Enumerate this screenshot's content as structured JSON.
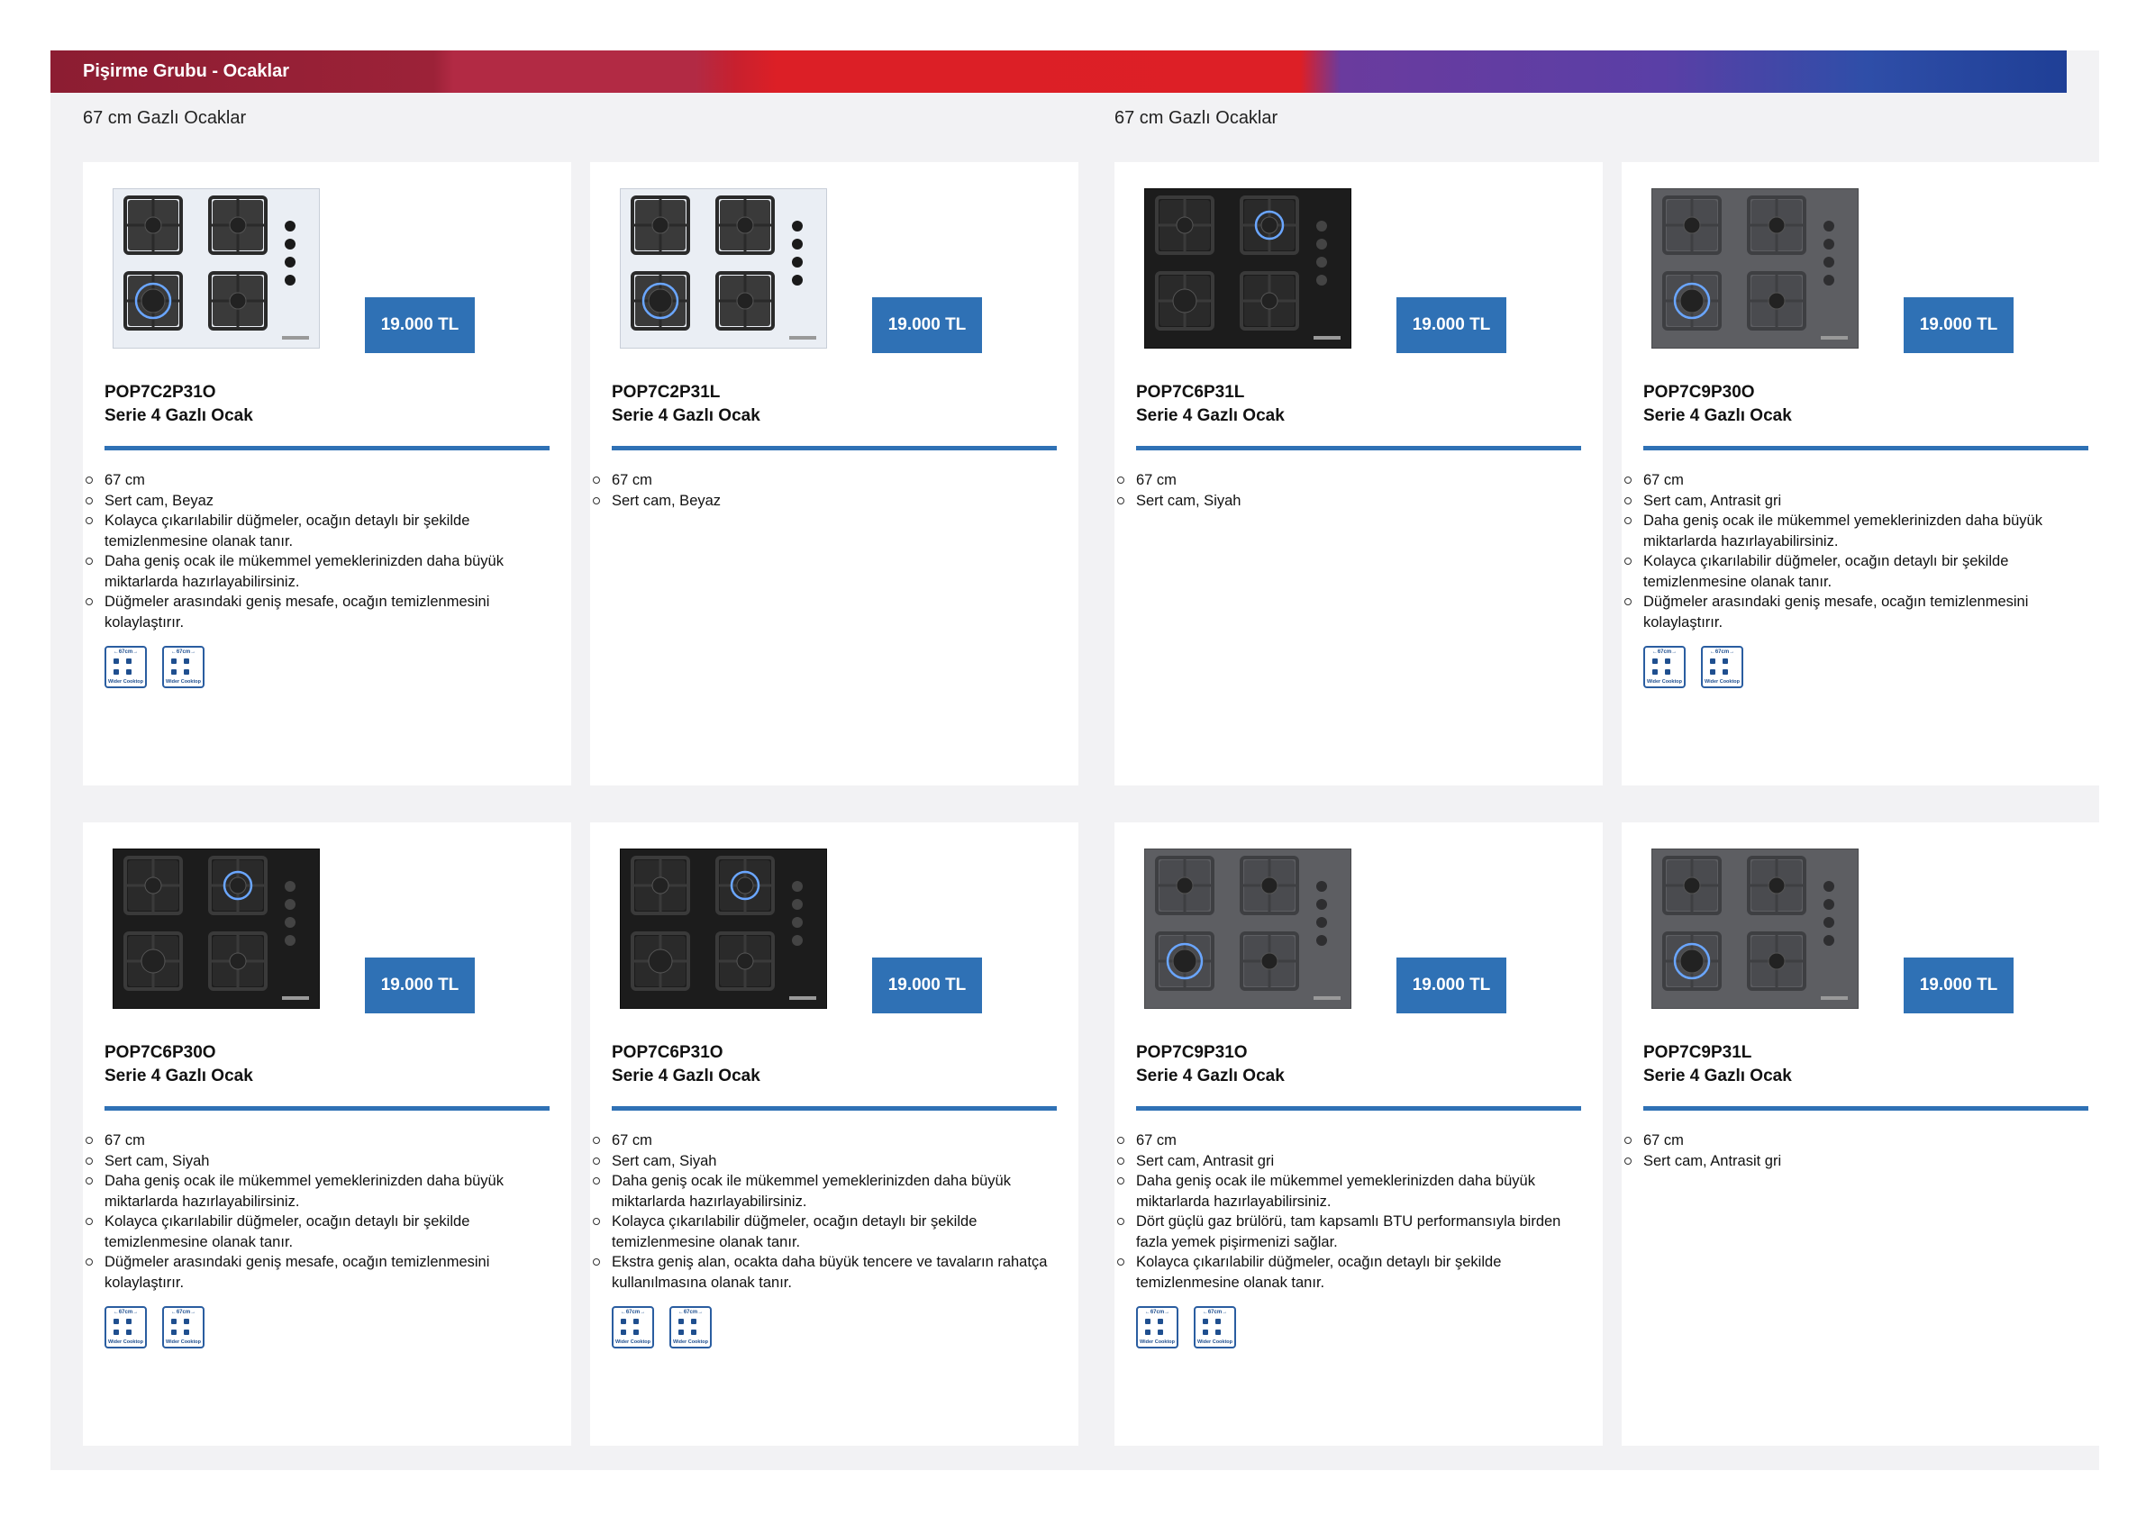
{
  "header": {
    "title": "Pişirme Grubu - Ocaklar"
  },
  "sections": [
    {
      "title": "67 cm Gazlı Ocaklar"
    },
    {
      "title": "67 cm Gazlı Ocaklar"
    }
  ],
  "badge": {
    "top": "←67cm→",
    "bottom": "Wider Cooktop"
  },
  "colors": {
    "accent": "#2f71b5",
    "white_glass": "#eef2f7",
    "black_glass": "#1e1e1e",
    "grey_glass": "#5f6064"
  },
  "cards": [
    {
      "model": "POP7C2P31O",
      "series": "Serie 4 Gazlı Ocak",
      "price": "19.000 TL",
      "finish": "white",
      "features": [
        "67 cm",
        "Sert cam, Beyaz",
        "Kolayca çıkarılabilir düğmeler, ocağın detaylı bir şekilde temizlenmesine olanak tanır.",
        "Daha geniş ocak ile mükemmel yemeklerinizden daha büyük miktarlarda hazırlayabilirsiniz.",
        "Düğmeler arasındaki geniş mesafe, ocağın temizlenmesini kolaylaştırır."
      ],
      "badges": 2
    },
    {
      "model": "POP7C2P31L",
      "series": "Serie 4 Gazlı Ocak",
      "price": "19.000 TL",
      "finish": "white",
      "features": [
        "67 cm",
        "Sert cam, Beyaz"
      ],
      "badges": 0
    },
    {
      "model": "POP7C6P31L",
      "series": "Serie 4 Gazlı Ocak",
      "price": "19.000 TL",
      "finish": "black",
      "features": [
        "67 cm",
        "Sert cam, Siyah"
      ],
      "badges": 0
    },
    {
      "model": "POP7C9P30O",
      "series": "Serie 4 Gazlı Ocak",
      "price": "19.000 TL",
      "finish": "grey",
      "features": [
        "67 cm",
        "Sert cam, Antrasit gri",
        "Daha geniş ocak ile mükemmel yemeklerinizden daha büyük miktarlarda hazırlayabilirsiniz.",
        "Kolayca çıkarılabilir düğmeler, ocağın detaylı bir şekilde temizlenmesine olanak tanır.",
        "Düğmeler arasındaki geniş mesafe, ocağın temizlenmesini kolaylaştırır."
      ],
      "badges": 2
    },
    {
      "model": "POP7C6P30O",
      "series": "Serie 4 Gazlı Ocak",
      "price": "19.000 TL",
      "finish": "black",
      "features": [
        "67 cm",
        "Sert cam, Siyah",
        "Daha geniş ocak ile mükemmel yemeklerinizden daha büyük miktarlarda hazırlayabilirsiniz.",
        "Kolayca çıkarılabilir düğmeler, ocağın detaylı bir şekilde temizlenmesine olanak tanır.",
        "Düğmeler arasındaki geniş mesafe, ocağın temizlenmesini kolaylaştırır."
      ],
      "badges": 2
    },
    {
      "model": "POP7C6P31O",
      "series": "Serie 4 Gazlı Ocak",
      "price": "19.000 TL",
      "finish": "black",
      "features": [
        "67 cm",
        "Sert cam, Siyah",
        "Daha geniş ocak ile mükemmel yemeklerinizden daha büyük miktarlarda hazırlayabilirsiniz.",
        "Kolayca çıkarılabilir düğmeler, ocağın detaylı bir şekilde temizlenmesine olanak tanır.",
        "Ekstra geniş alan, ocakta daha büyük tencere ve tavaların rahatça kullanılmasına olanak tanır."
      ],
      "badges": 2
    },
    {
      "model": "POP7C9P31O",
      "series": "Serie 4 Gazlı Ocak",
      "price": "19.000 TL",
      "finish": "grey",
      "features": [
        "67 cm",
        "Sert cam, Antrasit gri",
        "Daha geniş ocak ile mükemmel yemeklerinizden daha büyük miktarlarda hazırlayabilirsiniz.",
        "Dört güçlü gaz brülörü, tam kapsamlı BTU performansıyla birden fazla yemek pişirmenizi sağlar.",
        "Kolayca çıkarılabilir düğmeler, ocağın detaylı bir şekilde temizlenmesine olanak tanır."
      ],
      "badges": 2
    },
    {
      "model": "POP7C9P31L",
      "series": "Serie 4 Gazlı Ocak",
      "price": "19.000 TL",
      "finish": "grey",
      "features": [
        "67 cm",
        "Sert cam, Antrasit gri"
      ],
      "badges": 0
    }
  ]
}
